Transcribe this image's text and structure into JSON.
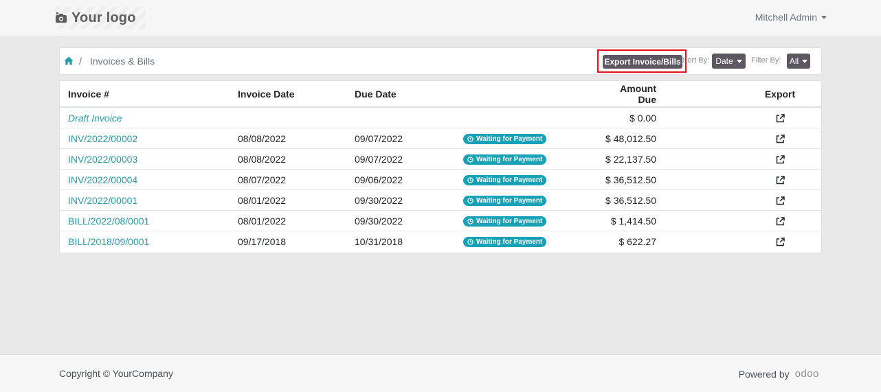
{
  "header": {
    "logo_text": "Your logo",
    "user_name": "Mitchell Admin"
  },
  "breadcrumb": {
    "separator": "/",
    "current": "Invoices & Bills"
  },
  "toolbar": {
    "export_label": "Export Invoice/Bills",
    "sort_label": "Sort By:",
    "sort_value": "Date",
    "filter_label": "Filter By:",
    "filter_value": "All"
  },
  "table": {
    "columns": [
      "Invoice #",
      "Invoice Date",
      "Due Date",
      "",
      "Amount Due",
      "Export"
    ],
    "rows": [
      {
        "number": "Draft Invoice",
        "invoice_date": "",
        "due_date": "",
        "status": "",
        "amount": "$ 0.00"
      },
      {
        "number": "INV/2022/00002",
        "invoice_date": "08/08/2022",
        "due_date": "09/07/2022",
        "status": "Waiting for Payment",
        "amount": "$ 48,012.50"
      },
      {
        "number": "INV/2022/00003",
        "invoice_date": "08/08/2022",
        "due_date": "09/07/2022",
        "status": "Waiting for Payment",
        "amount": "$ 22,137.50"
      },
      {
        "number": "INV/2022/00004",
        "invoice_date": "08/07/2022",
        "due_date": "09/06/2022",
        "status": "Waiting for Payment",
        "amount": "$ 36,512.50"
      },
      {
        "number": "INV/2022/00001",
        "invoice_date": "08/01/2022",
        "due_date": "09/30/2022",
        "status": "Waiting for Payment",
        "amount": "$ 36,512.50"
      },
      {
        "number": "BILL/2022/08/0001",
        "invoice_date": "08/01/2022",
        "due_date": "09/30/2022",
        "status": "Waiting for Payment",
        "amount": "$ 1,414.50"
      },
      {
        "number": "BILL/2018/09/0001",
        "invoice_date": "09/17/2018",
        "due_date": "10/31/2018",
        "status": "Waiting for Payment",
        "amount": "$ 622.27"
      }
    ]
  },
  "footer": {
    "copyright": "Copyright © YourCompany",
    "powered_by": "Powered by",
    "brand": "odoo"
  },
  "colors": {
    "link": "#2a9bab",
    "badge": "#17a2b8",
    "button": "#5c5760",
    "highlight_border": "#e4121b"
  },
  "icons": {
    "logo": "camera-icon",
    "home": "home-icon",
    "status": "clock-icon",
    "export": "external-link-icon"
  }
}
